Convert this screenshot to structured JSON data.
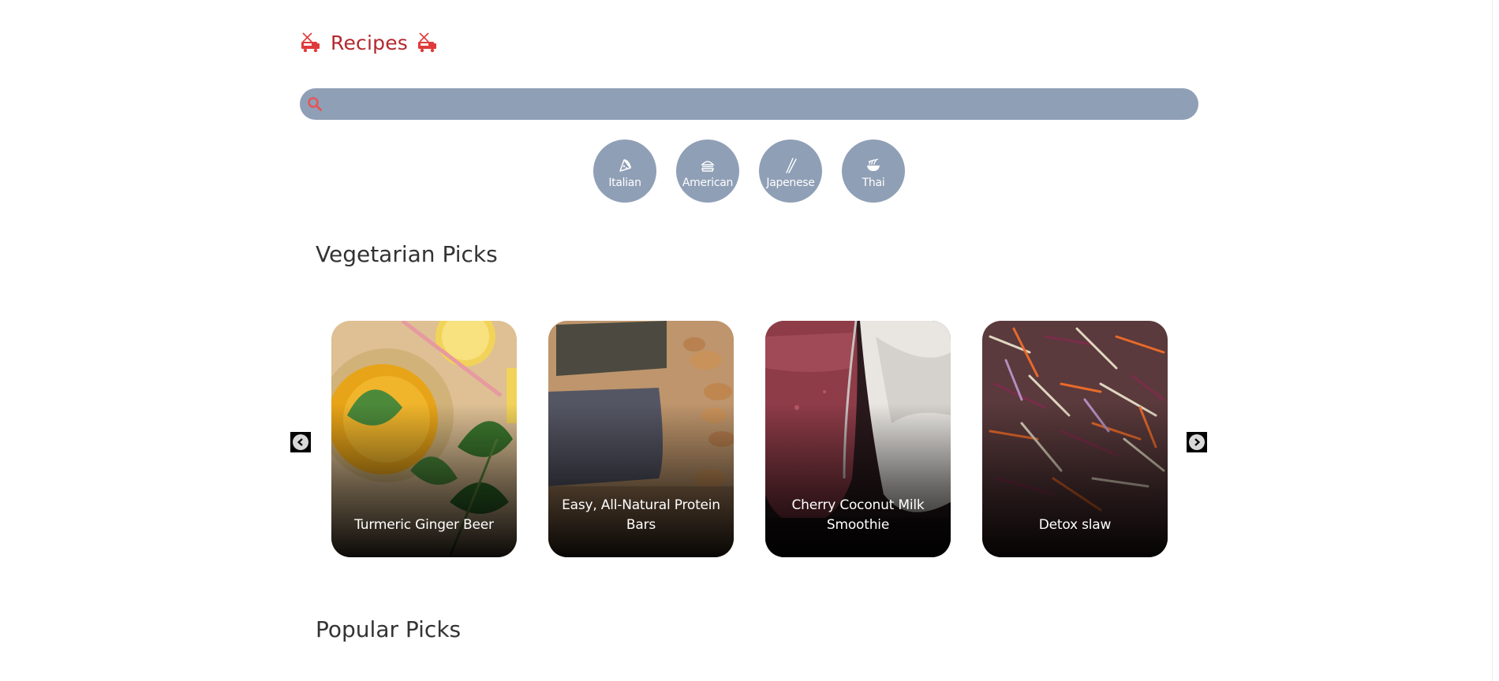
{
  "header": {
    "title": "Recipes",
    "brand_color": "#b3282d",
    "icons": [
      "food-truck-icon",
      "food-truck-icon"
    ]
  },
  "search": {
    "value": "",
    "placeholder": "",
    "icon": "search-icon",
    "background": "#8f9fb6",
    "icon_color": "#e25757"
  },
  "cuisines": [
    {
      "label": "Italian",
      "icon": "pizza-icon"
    },
    {
      "label": "American",
      "icon": "burger-icon"
    },
    {
      "label": "Japenese",
      "icon": "chopsticks-icon"
    },
    {
      "label": "Thai",
      "icon": "noodle-bowl-icon"
    }
  ],
  "sections": {
    "vegetarian": {
      "title": "Vegetarian Picks"
    },
    "popular": {
      "title": "Popular Picks"
    }
  },
  "carousel": {
    "prev_icon": "chevron-left-icon",
    "next_icon": "chevron-right-icon",
    "cards": [
      {
        "title": "Turmeric Ginger Beer"
      },
      {
        "title": "Easy, All-Natural Protein Bars"
      },
      {
        "title": "Cherry Coconut Milk Smoothie"
      },
      {
        "title": "Detox slaw"
      }
    ]
  }
}
